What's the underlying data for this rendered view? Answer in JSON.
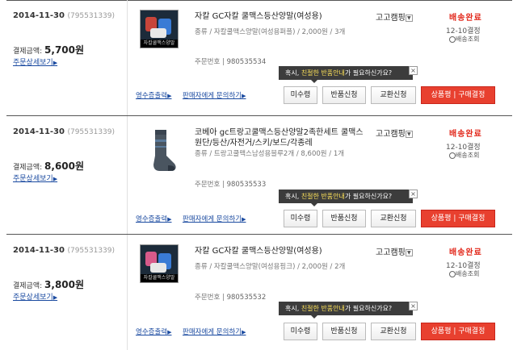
{
  "orders": [
    {
      "date": "2014-11-30",
      "order_no": "(795531339)",
      "pay_label": "결제금액:",
      "pay_amount": "5,700원",
      "detail_link": "주문상세보기",
      "product_name": "자칼 GC자칼 쿨맥스등산양말(여성용)",
      "option": "종류 / 자칼쿨맥스양말(여성용퍼플) / 2,000원 / 3개",
      "order_label": "주문번호 |",
      "order_number": "980535534",
      "thumb_caption": "자칼쿨맥스양말",
      "campaign": "고고캠핑",
      "status": "배송완료",
      "status_date": "12-10결정",
      "track": "배송조회",
      "tip_prefix": "혹시,",
      "tip_highlight": "친절한 반품안내",
      "tip_suffix": "가 필요하신가요?",
      "receipt_link": "영수증출력",
      "seller_link": "판매자에게 문의하기",
      "btn_unreceived": "미수령",
      "btn_return": "반품신청",
      "btn_exchange": "교환신청",
      "btn_review": "상품평 | 구매결정"
    },
    {
      "date": "2014-11-30",
      "order_no": "(795531339)",
      "pay_label": "결제금액:",
      "pay_amount": "8,600원",
      "detail_link": "주문상세보기",
      "product_name": "코베아 gc트랑고쿨맥스등산양말2족한세트 쿨맥스원단/등산/자전거/스키/보드/각종레",
      "option": "종류 / 트랑고쿨맥스남성용블루2개 / 8,600원 / 1개",
      "order_label": "주문번호 |",
      "order_number": "980535533",
      "thumb_caption": "",
      "campaign": "고고캠핑",
      "status": "배송완료",
      "status_date": "12-10결정",
      "track": "배송조회",
      "tip_prefix": "혹시,",
      "tip_highlight": "친절한 반품안내",
      "tip_suffix": "가 필요하신가요?",
      "receipt_link": "영수증출력",
      "seller_link": "판매자에게 문의하기",
      "btn_unreceived": "미수령",
      "btn_return": "반품신청",
      "btn_exchange": "교환신청",
      "btn_review": "상품평 | 구매결정"
    },
    {
      "date": "2014-11-30",
      "order_no": "(795531339)",
      "pay_label": "결제금액:",
      "pay_amount": "3,800원",
      "detail_link": "주문상세보기",
      "product_name": "자칼 GC자칼 쿨맥스등산양말(여성용)",
      "option": "종류 / 자칼쿨맥스양말(여성용핑크) / 2,000원 / 2개",
      "order_label": "주문번호 |",
      "order_number": "980535532",
      "thumb_caption": "자칼쿨맥스양말",
      "campaign": "고고캠핑",
      "status": "배송완료",
      "status_date": "12-10결정",
      "track": "배송조회",
      "tip_prefix": "혹시,",
      "tip_highlight": "친절한 반품안내",
      "tip_suffix": "가 필요하신가요?",
      "receipt_link": "영수증출력",
      "seller_link": "판매자에게 문의하기",
      "btn_unreceived": "미수령",
      "btn_return": "반품신청",
      "btn_exchange": "교환신청",
      "btn_review": "상품평 | 구매결정"
    }
  ],
  "icons": {
    "dropdown": "chevron-down-icon",
    "track": "magnifier-icon",
    "close": "close-icon"
  },
  "colors": {
    "status": "#e2281b",
    "link": "#1a4aa0",
    "review_button": "#e8402f",
    "tooltip_bg": "#3c3c3c",
    "tooltip_highlight": "#ffe35a"
  }
}
